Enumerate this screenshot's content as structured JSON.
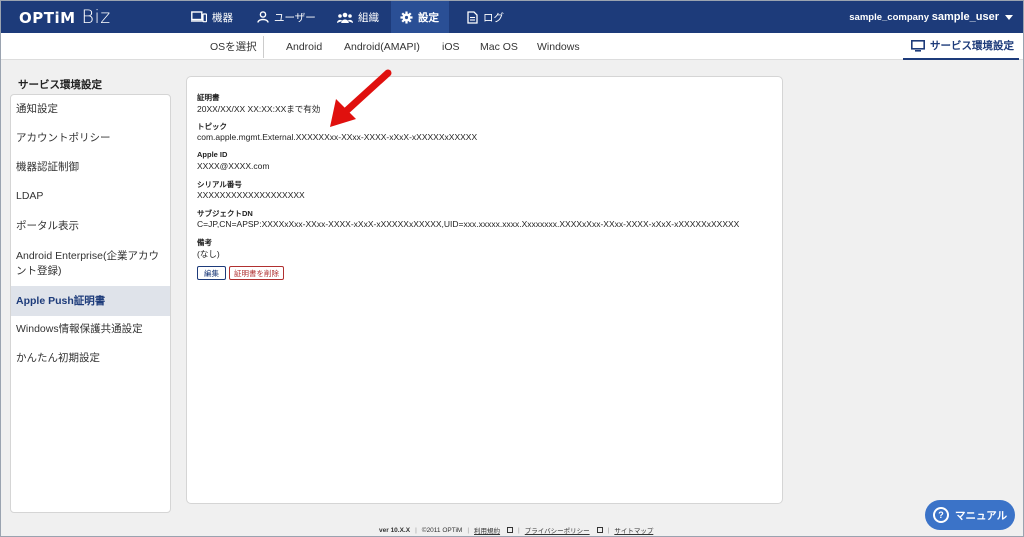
{
  "header": {
    "logo_brand": "OPTiM",
    "logo_product": "Biz",
    "nav": [
      {
        "label": "機器",
        "icon": "devices-icon"
      },
      {
        "label": "ユーザー",
        "icon": "user-icon"
      },
      {
        "label": "組織",
        "icon": "organization-icon"
      },
      {
        "label": "設定",
        "icon": "gear-icon",
        "active": true
      },
      {
        "label": "ログ",
        "icon": "log-icon"
      }
    ],
    "company": "sample_company",
    "user": "sample_user"
  },
  "subnav": {
    "os_select": "OSを選択",
    "tabs": [
      "Android",
      "Android(AMAPI)",
      "iOS",
      "Mac OS",
      "Windows"
    ],
    "service_settings": "サービス環境設定"
  },
  "sidebar": {
    "title": "サービス環境設定",
    "items": [
      {
        "label": "通知設定"
      },
      {
        "label": "アカウントポリシー"
      },
      {
        "label": "機器認証制御"
      },
      {
        "label": "LDAP"
      },
      {
        "label": "ポータル表示"
      },
      {
        "label": "Android Enterprise(企業アカウント登録)"
      },
      {
        "label": "Apple Push証明書",
        "active": true
      },
      {
        "label": "Windows情報保護共通設定"
      },
      {
        "label": "かんたん初期設定"
      }
    ]
  },
  "certificate": {
    "cert_label": "証明書",
    "cert_value": "20XX/XX/XX XX:XX:XXまで有効",
    "topic_label": "トピック",
    "topic_value": "com.apple.mgmt.External.XXXXXXxx-XXxx-XXXX-xXxX-xXXXXXxXXXXX",
    "apple_id_label": "Apple ID",
    "apple_id_value": "XXXX@XXXX.com",
    "serial_label": "シリアル番号",
    "serial_value": "XXXXXXXXXXXXXXXXXXX",
    "subject_label": "サブジェクトDN",
    "subject_value": "C=JP,CN=APSP:XXXXxXxx-XXxx-XXXX-xXxX-xXXXXXxXXXXX,UID=xxx.xxxxx.xxxx.Xxxxxxxx.XXXXxXxx-XXxx-XXXX-xXxX-xXXXXXxXXXXX",
    "notes_label": "備考",
    "notes_value": "(なし)",
    "edit_button": "編集",
    "delete_button": "証明書を削除"
  },
  "footer": {
    "version": "ver 10.X.X",
    "copyright": "©2011 OPTiM",
    "terms": "利用規約",
    "privacy": "プライバシーポリシー",
    "sitemap": "サイトマップ"
  },
  "manual_button": "マニュアル",
  "colors": {
    "header_bg": "#1d3b7a",
    "accent": "#1d3b7a",
    "danger": "#b03030",
    "arrow": "#e0100e",
    "manual_bg": "#3b73c8"
  }
}
